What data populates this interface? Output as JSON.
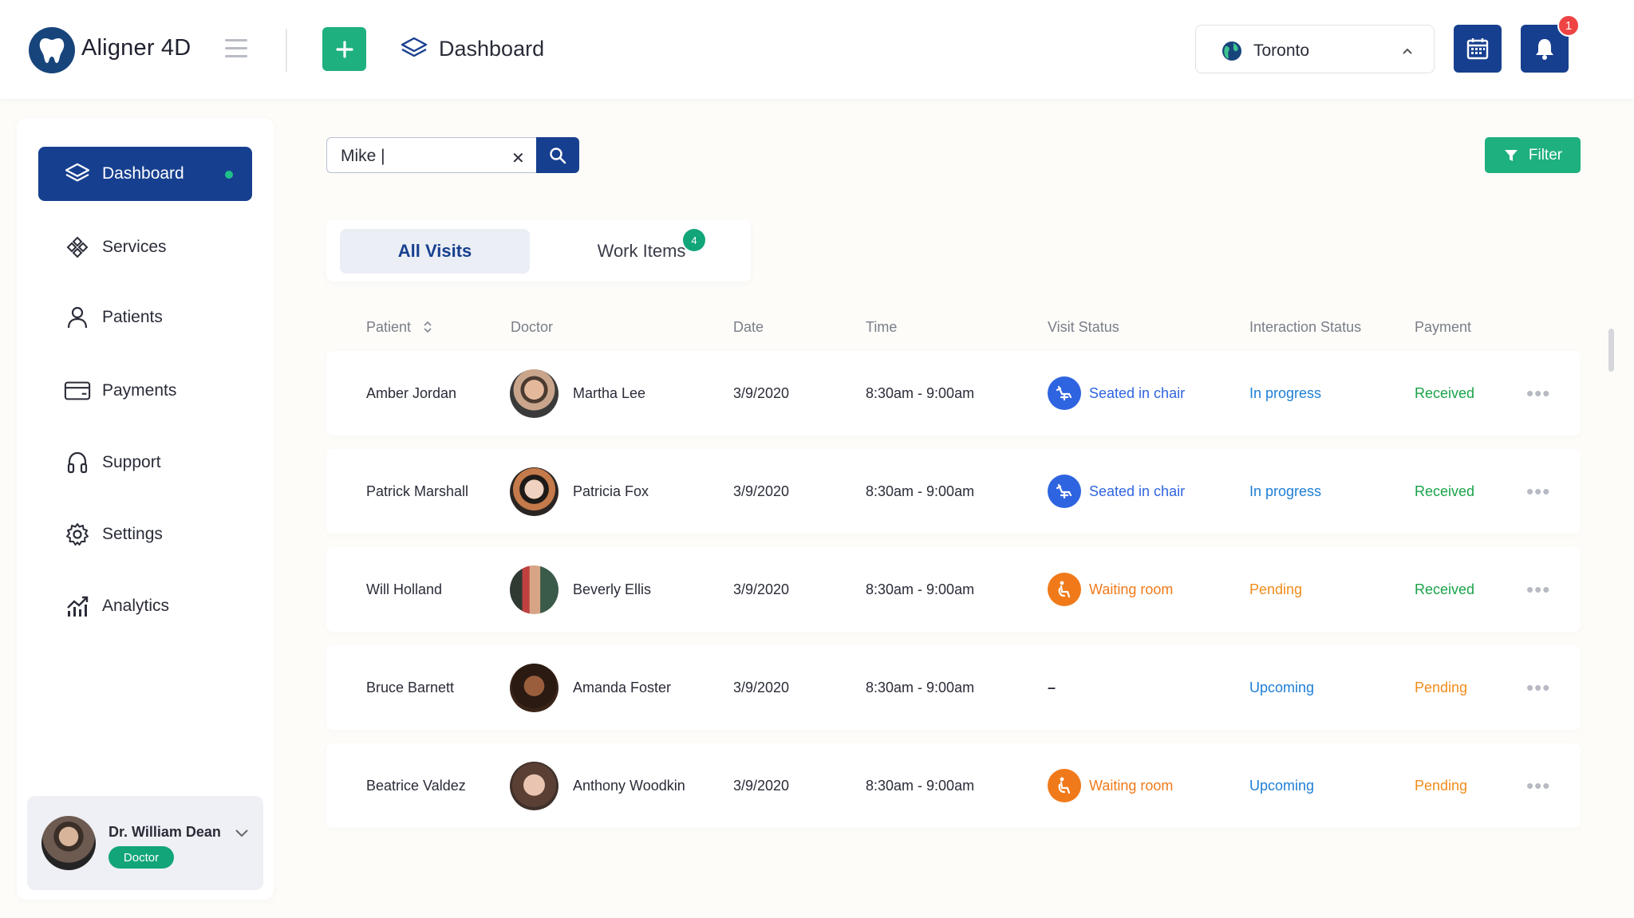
{
  "app": {
    "name": "Aligner 4D",
    "page_title": "Dashboard"
  },
  "topbar": {
    "location": "Toronto",
    "notification_count": "1"
  },
  "sidebar": {
    "items": [
      {
        "label": "Dashboard",
        "icon": "layers-icon",
        "active": true
      },
      {
        "label": "Services",
        "icon": "services-icon"
      },
      {
        "label": "Patients",
        "icon": "user-icon"
      },
      {
        "label": "Payments",
        "icon": "card-icon"
      },
      {
        "label": "Support",
        "icon": "headset-icon"
      },
      {
        "label": "Settings",
        "icon": "gear-icon"
      },
      {
        "label": "Analytics",
        "icon": "chart-icon"
      }
    ],
    "user": {
      "name": "Dr. William Dean",
      "role": "Doctor"
    }
  },
  "search": {
    "value": "Mike |",
    "clear": "✕"
  },
  "filter_label": "Filter",
  "tabs": [
    {
      "label": "All Visits",
      "active": true
    },
    {
      "label": "Work Items",
      "badge": "4"
    }
  ],
  "table": {
    "headers": [
      "Patient",
      "Doctor",
      "Date",
      "Time",
      "Visit Status",
      "Interaction Status",
      "Payment"
    ],
    "rows": [
      {
        "patient": "Amber Jordan",
        "doctor": "Martha Lee",
        "date": "3/9/2020",
        "time": "8:30am - 9:00am",
        "visit": "Seated in chair",
        "interaction": "In progress",
        "payment": "Received"
      },
      {
        "patient": "Patrick Marshall",
        "doctor": "Patricia Fox",
        "date": "3/9/2020",
        "time": "8:30am - 9:00am",
        "visit": "Seated in chair",
        "interaction": "In progress",
        "payment": "Received"
      },
      {
        "patient": "Will Holland",
        "doctor": "Beverly Ellis",
        "date": "3/9/2020",
        "time": "8:30am - 9:00am",
        "visit": "Waiting room",
        "interaction": "Pending",
        "payment": "Received"
      },
      {
        "patient": "Bruce Barnett",
        "doctor": "Amanda Foster",
        "date": "3/9/2020",
        "time": "8:30am - 9:00am",
        "visit": "–",
        "interaction": "Upcoming",
        "payment": "Pending"
      },
      {
        "patient": "Beatrice Valdez",
        "doctor": "Anthony Woodkin",
        "date": "3/9/2020",
        "time": "8:30am - 9:00am",
        "visit": "Waiting room",
        "interaction": "Upcoming",
        "payment": "Pending"
      }
    ],
    "more": "•••"
  },
  "colors": {
    "primary": "#173f8f",
    "accent_green": "#1fb07f",
    "status_blue": "#2f64e0",
    "status_orange": "#f07a1a",
    "received_green": "#1aa34a",
    "pending_orange": "#f08c1c",
    "upcoming_blue": "#1d7ed6"
  }
}
